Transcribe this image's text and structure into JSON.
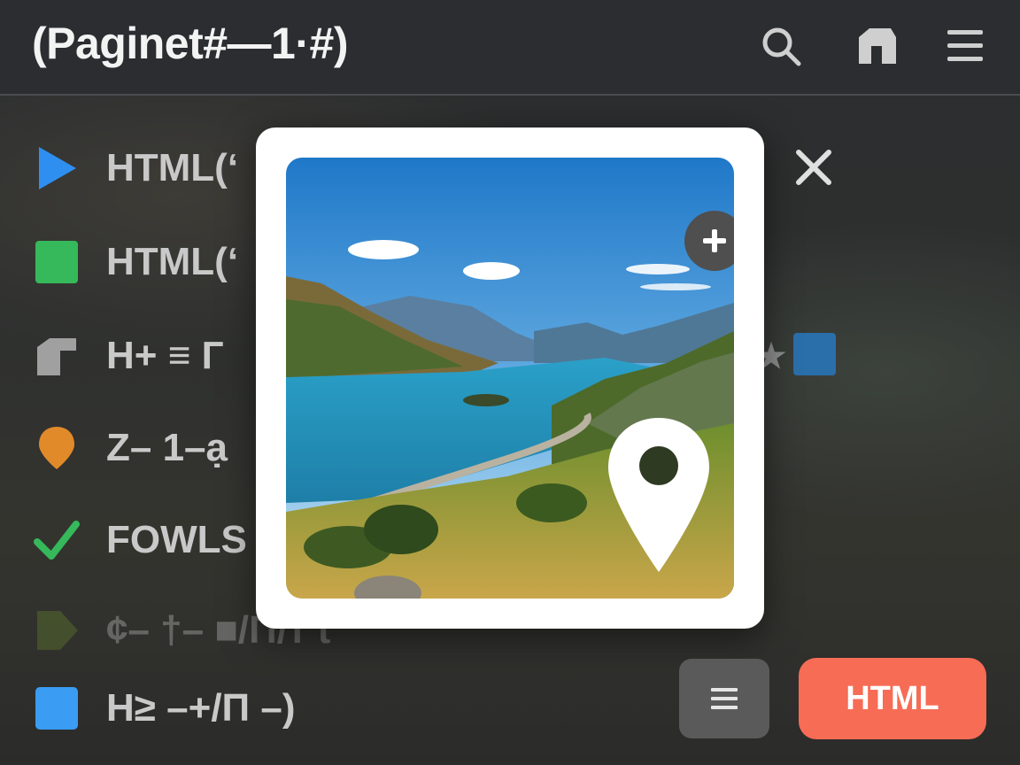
{
  "header": {
    "title": "(Paginet#—1·#)",
    "icons": [
      "search-icon",
      "home-icon",
      "hamburger-menu-icon"
    ]
  },
  "list": {
    "items": [
      {
        "label": "HTML(‘",
        "icon": "play-triangle-icon",
        "color": "#2e8ff0"
      },
      {
        "label": "HTML(‘",
        "icon": "square-icon",
        "color": "#35b95a"
      },
      {
        "label": "H+ ≡ Г",
        "icon": "shape-icon",
        "color": "#9a9a9a"
      },
      {
        "label": "Z– 1–ạ",
        "icon": "map-pin-icon",
        "color": "#e08a2a"
      },
      {
        "label": "FOWLS",
        "icon": "check-icon",
        "color": "#35b95a"
      },
      {
        "label": "¢– †– ■/П/т t",
        "icon": "play-triangle-icon",
        "color": "#5b6b2e"
      },
      {
        "label": "H≥ –+/П –)",
        "icon": "square-icon",
        "color": "#3a9cf2"
      }
    ]
  },
  "modal": {
    "image": "landscape-photo",
    "add_icon": "plus-icon",
    "pin_icon": "map-pin-icon"
  },
  "side": {
    "close_icon": "close-icon",
    "fragment": "★"
  },
  "footer": {
    "menu_icon": "hamburger-menu-icon",
    "primary_label": "HTML"
  },
  "colors": {
    "accent": "#f76c55",
    "background": "#2a2c2e",
    "modal": "#ffffff"
  }
}
